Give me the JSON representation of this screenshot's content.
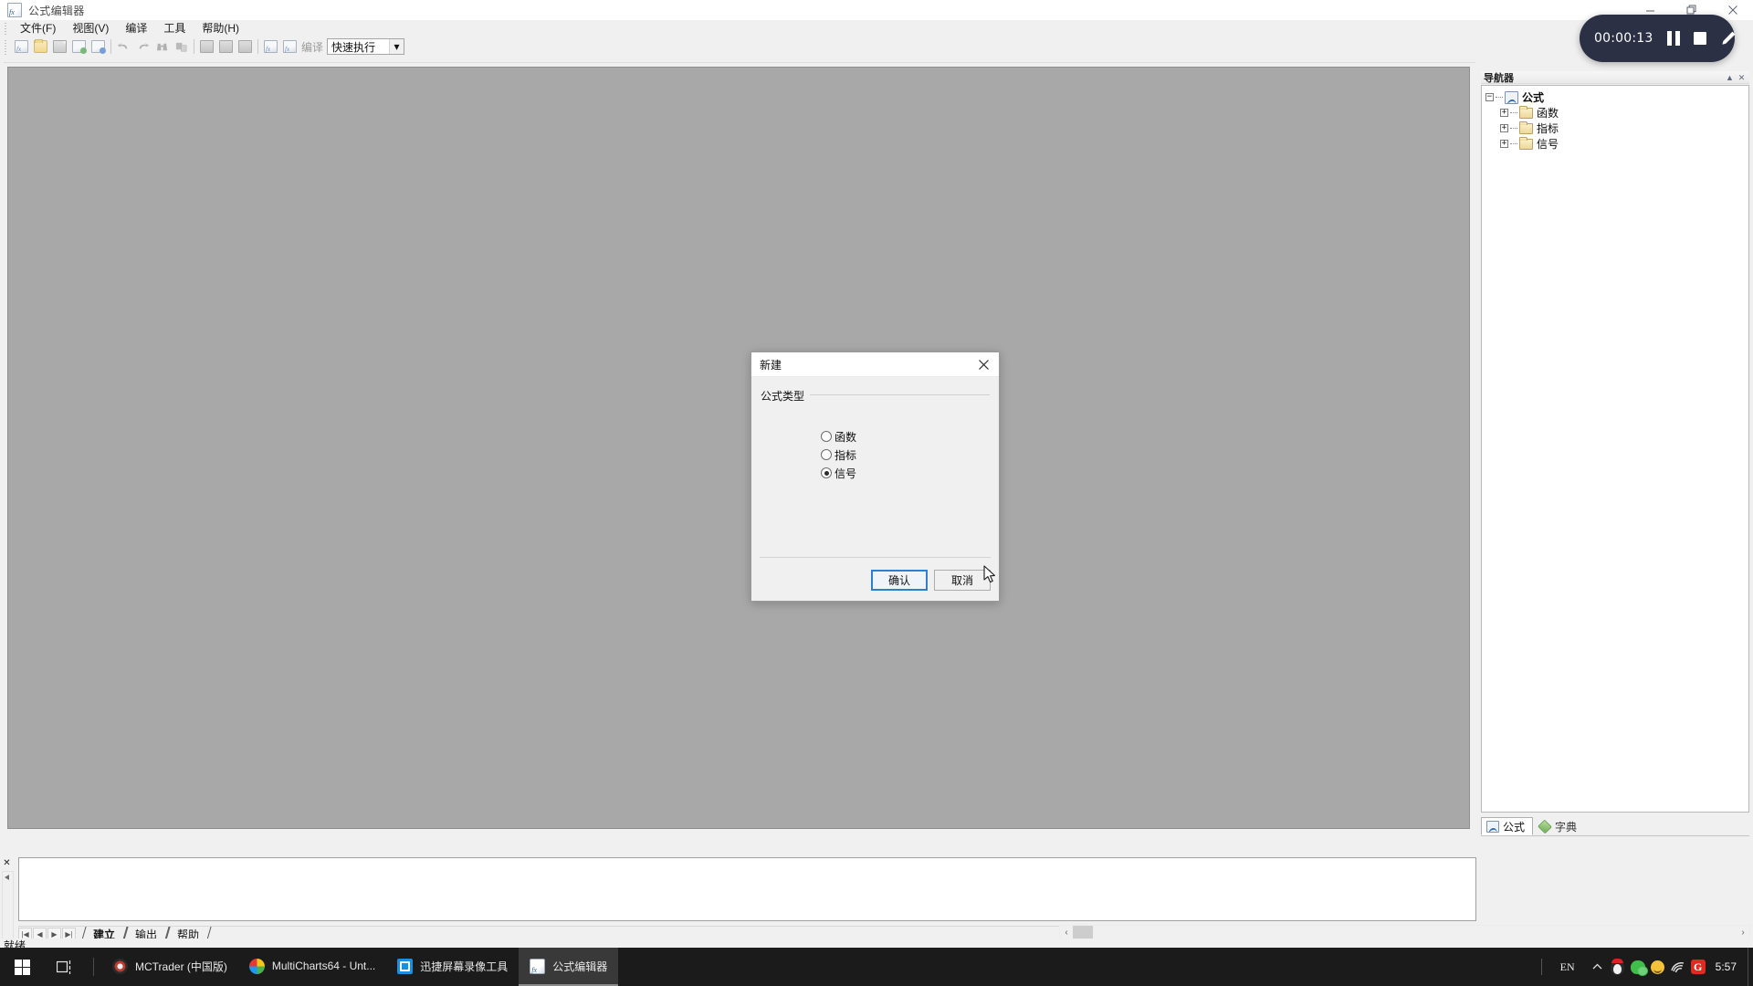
{
  "window": {
    "title": "公式编辑器",
    "icon": "formula-editor-icon",
    "controls": {
      "minimize": "–",
      "restore": "❐",
      "close": "✕"
    }
  },
  "menubar": {
    "items": [
      {
        "label": "文件(F)",
        "name": "menu-file"
      },
      {
        "label": "视图(V)",
        "name": "menu-view"
      },
      {
        "label": "编译",
        "name": "menu-compile"
      },
      {
        "label": "工具",
        "name": "menu-tools"
      },
      {
        "label": "帮助(H)",
        "name": "menu-help"
      }
    ]
  },
  "toolbar": {
    "compile_label": "编译",
    "quick_exec": {
      "value": "快速执行",
      "arrow": "▾"
    },
    "buttons": [
      {
        "name": "new-formula-button",
        "icon": "new-formula-icon"
      },
      {
        "name": "open-button",
        "icon": "folder-open-icon"
      },
      {
        "name": "save-button",
        "icon": "save-icon"
      },
      {
        "name": "new-function-button",
        "icon": "formula-green-icon"
      },
      {
        "name": "new-indicator-button",
        "icon": "formula-blue-icon"
      },
      {
        "name": "undo-button",
        "icon": "undo-arrow-icon"
      },
      {
        "name": "redo-button",
        "icon": "redo-arrow-icon"
      },
      {
        "name": "find-button",
        "icon": "binoculars-icon"
      },
      {
        "name": "replace-button",
        "icon": "replace-icon"
      },
      {
        "name": "copy-button",
        "icon": "copy-icon"
      },
      {
        "name": "cut-button",
        "icon": "cut-icon"
      },
      {
        "name": "paste-button",
        "icon": "paste-icon"
      },
      {
        "name": "verify-button",
        "icon": "verify-doc-icon"
      },
      {
        "name": "compile-button",
        "icon": "compile-doc-icon"
      }
    ]
  },
  "dialog": {
    "title": "新建",
    "close": "✕",
    "group_legend": "公式类型",
    "options": [
      {
        "label": "函数",
        "checked": false,
        "name": "radio-function"
      },
      {
        "label": "指标",
        "checked": false,
        "name": "radio-indicator"
      },
      {
        "label": "信号",
        "checked": true,
        "name": "radio-signal"
      }
    ],
    "ok_label": "确认",
    "cancel_label": "取消",
    "accent": "#2f7fd0"
  },
  "navigator": {
    "title": "导航器",
    "collapse_icon": "▲",
    "close_icon": "✕",
    "tree": {
      "root": {
        "label": "公式",
        "toggle": "−",
        "icon": "formula-icon"
      },
      "children": [
        {
          "label": "函数",
          "toggle": "+",
          "icon": "folder-icon"
        },
        {
          "label": "指标",
          "toggle": "+",
          "icon": "folder-icon"
        },
        {
          "label": "信号",
          "toggle": "+",
          "icon": "folder-icon"
        }
      ]
    },
    "tabs": [
      {
        "label": "公式",
        "active": true,
        "icon": "formula-icon"
      },
      {
        "label": "字典",
        "active": false,
        "icon": "dictionary-icon"
      }
    ]
  },
  "output_pane": {
    "close": "✕",
    "content": "",
    "nav_buttons": [
      "|◀",
      "◀",
      "▶",
      "▶|"
    ],
    "tabs": [
      {
        "label": "建立",
        "active": true
      },
      {
        "label": "输出",
        "active": false
      },
      {
        "label": "帮助",
        "active": false
      }
    ]
  },
  "scrollbar": {
    "left_arrow": "‹",
    "right_arrow": "›"
  },
  "statusbar": {
    "text": "就绪"
  },
  "recorder": {
    "time": "00:00:13",
    "pause": "pause-icon",
    "stop": "stop-icon",
    "pencil": "pencil-icon"
  },
  "taskbar": {
    "start": "windows-logo-icon",
    "task_view": "task-view-icon",
    "items": [
      {
        "label": "MCTrader (中国版)",
        "icon": "mctrader-icon",
        "active": false
      },
      {
        "label": "MultiCharts64 - Unt...",
        "icon": "multicharts-icon",
        "active": false
      },
      {
        "label": "迅捷屏幕录像工具",
        "icon": "screen-recorder-icon",
        "active": false
      },
      {
        "label": "公式编辑器",
        "icon": "formula-editor-icon",
        "active": true
      }
    ],
    "tray": {
      "ime": "EN",
      "chevron": "^",
      "icons": [
        "qq-penguin-icon",
        "wechat-icon",
        "smiley-icon",
        "wifi-icon",
        "g-app-icon"
      ],
      "clock": "5:57"
    }
  }
}
